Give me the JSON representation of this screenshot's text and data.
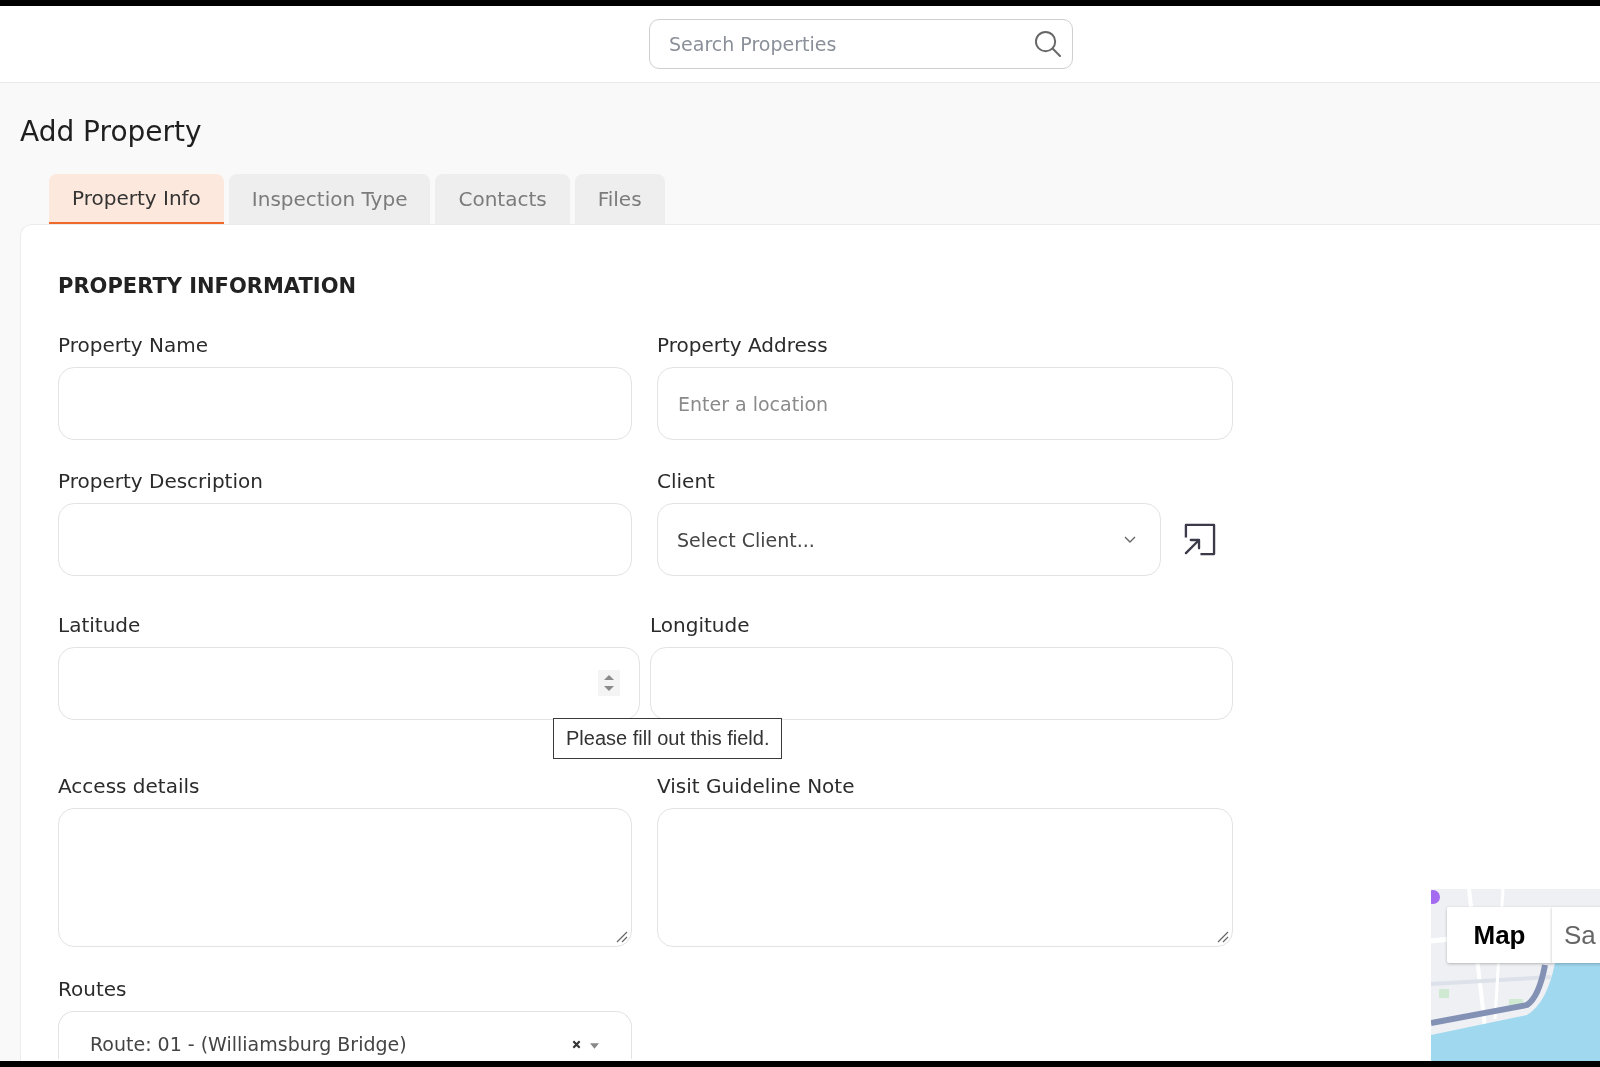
{
  "search": {
    "placeholder": "Search Properties"
  },
  "page_title": "Add Property",
  "tabs": [
    {
      "label": "Property Info",
      "selected": true
    },
    {
      "label": "Inspection Type",
      "selected": false
    },
    {
      "label": "Contacts",
      "selected": false
    },
    {
      "label": "Files",
      "selected": false
    }
  ],
  "section_title": "PROPERTY INFORMATION",
  "rows": [
    {
      "fields": [
        {
          "kind": "text",
          "label": "Property Name"
        },
        {
          "kind": "text",
          "label": "Property Address",
          "placeholder": "Enter a location"
        }
      ]
    },
    {
      "fields": [
        {
          "kind": "text",
          "label": "Property Description"
        },
        {
          "kind": "select",
          "label": "Client",
          "value": "Select Client..."
        }
      ]
    },
    {
      "fields": [
        {
          "kind": "number",
          "label": "Latitude",
          "tooltip": "Please fill out this field."
        },
        {
          "kind": "text",
          "label": "Longitude"
        }
      ]
    },
    {
      "fields": [
        {
          "kind": "textarea",
          "label": "Access details"
        },
        {
          "kind": "textarea",
          "label": "Visit Guideline Note"
        }
      ]
    },
    {
      "fields": [
        {
          "kind": "multiselect",
          "label": "Routes",
          "value": "Route: 01 - (Williamsburg Bridge)"
        }
      ]
    }
  ],
  "map": {
    "type_buttons": [
      {
        "label": "Map",
        "selected": true
      },
      {
        "label": "Sa",
        "selected": false
      }
    ]
  }
}
